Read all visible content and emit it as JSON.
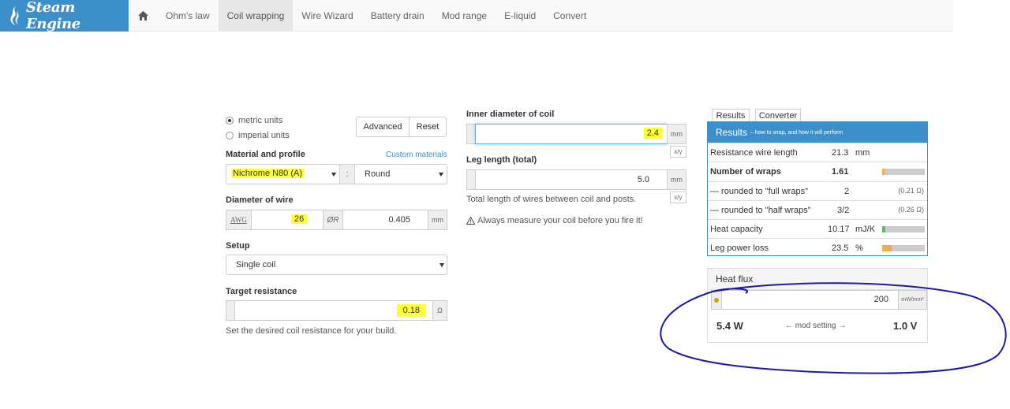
{
  "nav": {
    "brand": "Steam Engine",
    "items": [
      "Ohm's law",
      "Coil wrapping",
      "Wire Wizard",
      "Battery drain",
      "Mod range",
      "E-liquid",
      "Convert"
    ],
    "active": "Coil wrapping"
  },
  "units": {
    "metric": "metric units",
    "imperial": "imperial units",
    "selected": "metric units"
  },
  "buttons": {
    "advanced": "Advanced",
    "reset": "Reset"
  },
  "material": {
    "label": "Material and profile",
    "custom_link": "Custom materials",
    "value": "Nichrome N80 (A)",
    "separator": ":",
    "profile": "Round"
  },
  "diameter": {
    "label": "Diameter of wire",
    "awg_label": "AWG",
    "awg_value": "26",
    "symbol": "ØR",
    "mm_value": "0.405",
    "unit": "mm"
  },
  "setup": {
    "label": "Setup",
    "value": "Single coil"
  },
  "target": {
    "label": "Target resistance",
    "value": "0.18",
    "unit": "Ω",
    "help": "Set the desired coil resistance for your build."
  },
  "inner": {
    "label": "Inner diameter of coil",
    "value": "2.4",
    "unit": "mm",
    "ratio": "x/y"
  },
  "leg": {
    "label": "Leg length (total)",
    "value": "5.0",
    "unit": "mm",
    "ratio": "x/y",
    "help": "Total length of wires between coil and posts.",
    "warning": "Always measure your coil before you fire it!"
  },
  "tabs": {
    "results": "Results",
    "converter": "Converter"
  },
  "results": {
    "title": "Results",
    "subtitle": "– how to wrap, and how it will perform",
    "rows": [
      {
        "label": "Resistance wire length",
        "value": "21.3",
        "unit": "mm",
        "extra": ""
      },
      {
        "label": "Number of wraps",
        "value": "1.61",
        "unit": "",
        "extra": "",
        "bar": 0.06,
        "bar_color": "#f0ad4e"
      },
      {
        "label": "— rounded to \"full wraps\"",
        "value": "2",
        "unit": "",
        "extra": "(0.21 Ω)"
      },
      {
        "label": "— rounded to \"half wraps\"",
        "value": "3/2",
        "unit": "",
        "extra": "(0.26 Ω)"
      },
      {
        "label": "Heat capacity",
        "value": "10.17",
        "unit": "mJ/K",
        "extra": "",
        "bar": 0.08,
        "bar_color": "#5cb85c"
      },
      {
        "label": "Leg power loss",
        "value": "23.5",
        "unit": "%",
        "extra": "",
        "bar": 0.22,
        "bar_color": "#f0ad4e"
      }
    ]
  },
  "flux": {
    "title": "Heat flux",
    "value": "200",
    "unit": "mW/mm²",
    "watts": "5.4 W",
    "mod_setting": "← mod setting →",
    "volts": "1.0 V"
  },
  "colors": {
    "brand": "#3d8fc9",
    "highlight": "#ffff33",
    "annotation": "#1a1aa8"
  }
}
